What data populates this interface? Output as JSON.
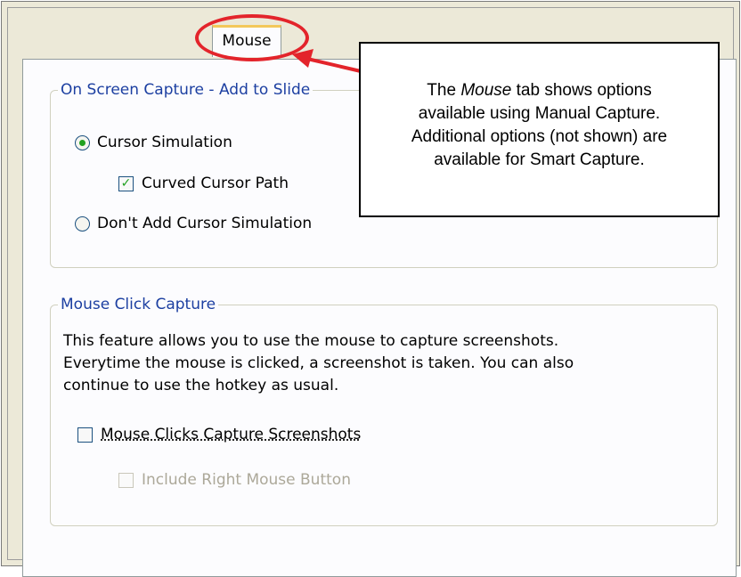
{
  "tab": {
    "label": "Mouse"
  },
  "on_screen_group": {
    "legend": "On Screen Capture - Add to Slide",
    "cursor_simulation": {
      "label": "Cursor Simulation",
      "checked": true
    },
    "curved_cursor_path": {
      "label": "Curved Cursor Path",
      "checked": true
    },
    "dont_add_cursor_simulation": {
      "label": "Don't Add Cursor Simulation",
      "checked": false
    }
  },
  "mouse_click_group": {
    "legend": "Mouse Click Capture",
    "description_lines": [
      "This feature allows you to use the mouse to capture screenshots.",
      "Everytime the mouse is clicked, a screenshot is taken. You can also",
      "continue to use the hotkey as usual."
    ],
    "mouse_clicks_capture": {
      "label": "Mouse Clicks Capture Screenshots",
      "checked": false
    },
    "include_right_button": {
      "label": "Include Right Mouse Button",
      "checked": false,
      "enabled": false
    }
  },
  "callout": {
    "line1_pre": "The ",
    "line1_em": "Mouse",
    "line1_post": " tab shows options",
    "line2": "available using Manual Capture.",
    "line3": "Additional options (not shown) are",
    "line4": "available for Smart Capture."
  },
  "annotation_colors": {
    "highlight": "#e3242b",
    "tab_accent": "#f3c85a",
    "legend_text": "#1c3fa1"
  }
}
